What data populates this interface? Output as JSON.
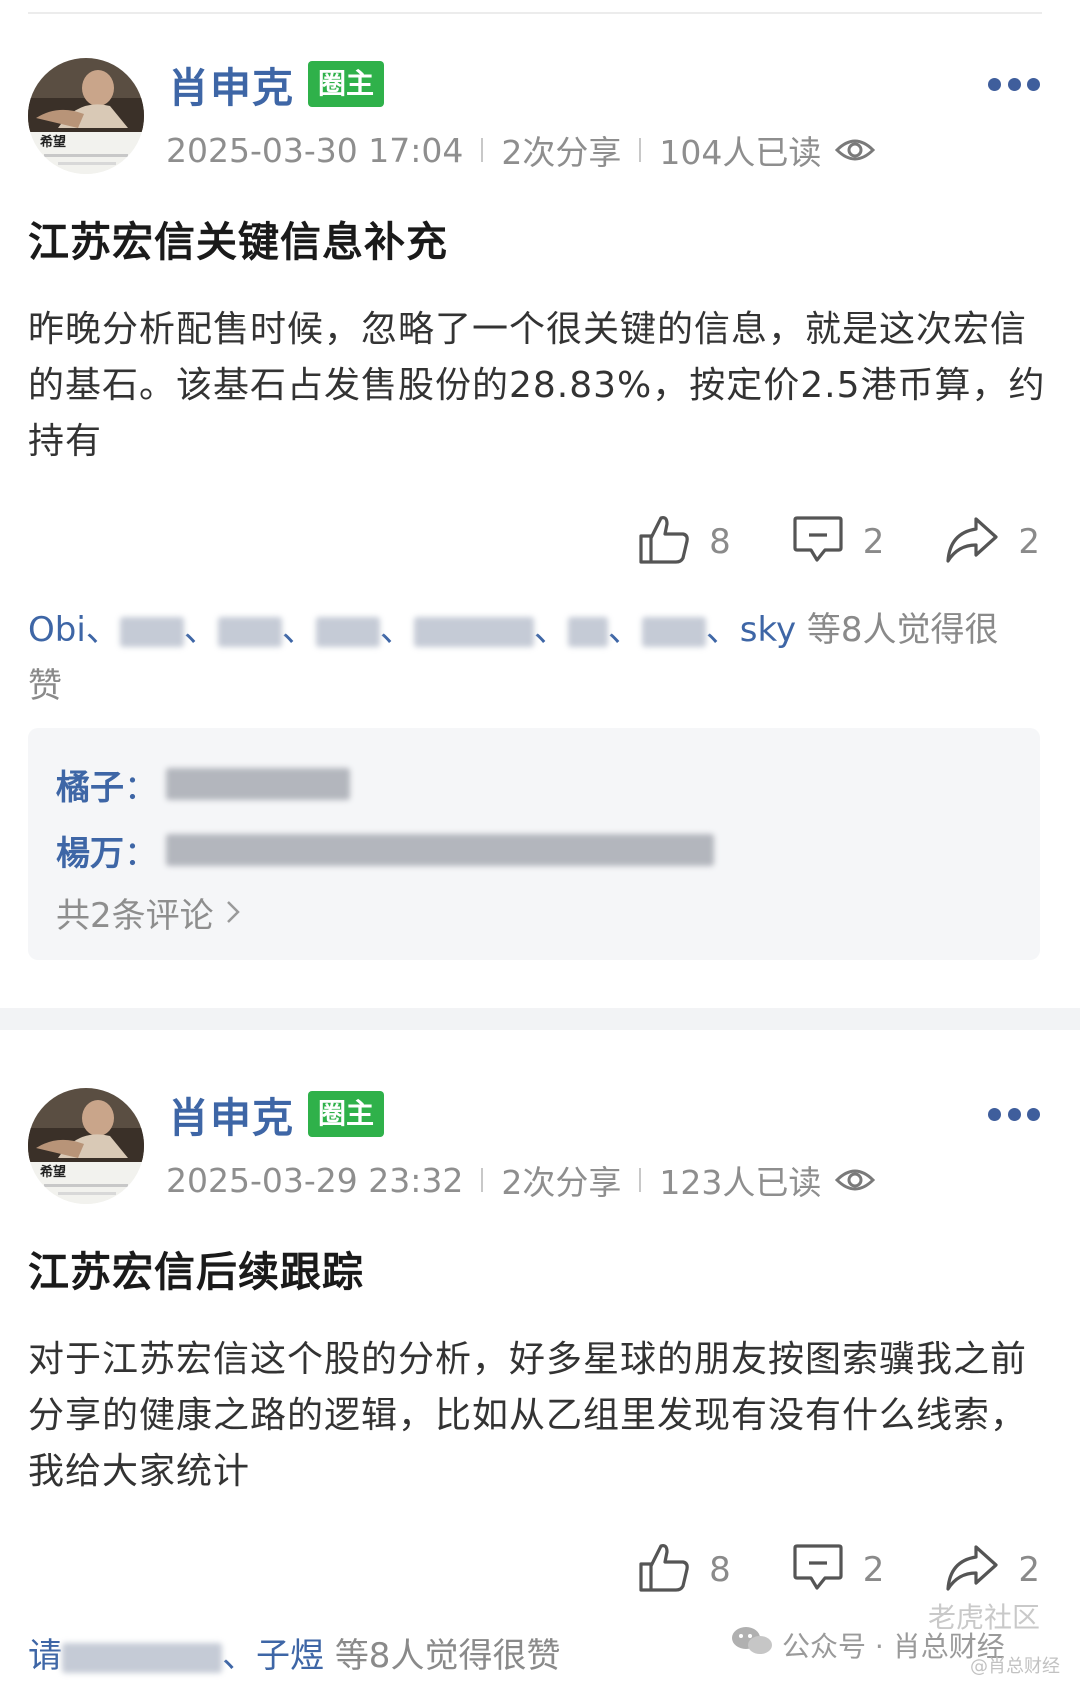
{
  "posts": [
    {
      "author": "肖申克",
      "badge": "圈主",
      "avatar_label": "希望",
      "date": "2025-03-30 17:04",
      "shares": "2次分享",
      "reads": "104人已读",
      "title": "江苏宏信关键信息补充",
      "body": "昨晚分析配售时候，忽略了一个很关键的信息，就是这次宏信的基石。该基石占发售股份的28.83%，按定价2.5港币算，约持有",
      "likes": "8",
      "comments_count": "2",
      "shares_count": "2",
      "likers_prefix": "Obi",
      "likers_suffix": "sky",
      "likers_text": "等8人觉得很赞",
      "comment_list": [
        {
          "who": "橘子",
          "colon": "："
        },
        {
          "who": "楊万",
          "colon": "："
        }
      ],
      "more_comments": "共2条评论"
    },
    {
      "author": "肖申克",
      "badge": "圈主",
      "avatar_label": "希望",
      "date": "2025-03-29 23:32",
      "shares": "2次分享",
      "reads": "123人已读",
      "title": "江苏宏信后续跟踪",
      "body": "对于江苏宏信这个股的分析，好多星球的朋友按图索骥我之前分享的健康之路的逻辑，比如从乙组里发现有没有什么线索，我给大家统计",
      "likes": "8",
      "comments_count": "2",
      "shares_count": "2",
      "likers_prefix": "请",
      "likers_suffix": "子煜",
      "likers_text": "等8人觉得很赞"
    }
  ],
  "watermark": {
    "tag": "老虎社区",
    "account": "公众号 · 肖总财经",
    "handle": "@肖总财经"
  },
  "colors": {
    "author": "#3e66a6",
    "badge": "#2fb14a",
    "muted": "#8e8e8e"
  },
  "icons": [
    "avatar-photo",
    "more-dots-icon",
    "eye-icon",
    "thumbs-up-icon",
    "comment-icon",
    "share-arrow-icon",
    "chevron-right-icon",
    "wechat-icon"
  ]
}
